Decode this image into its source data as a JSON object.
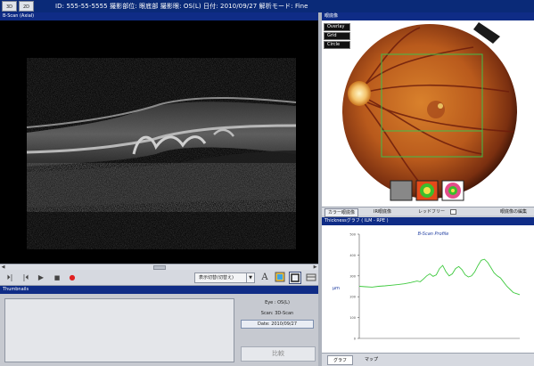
{
  "header": {
    "tab_3d": "3D",
    "tab_2d": "2D",
    "info": "ID: 555-55-5555   撮影部位: 眼底部   撮影眼: OS(L)   日付: 2010/09/27   解析モード: Fine"
  },
  "bscan": {
    "title": "B-Scan (Axial)"
  },
  "player": {
    "view_select": "表示切替(切替え)",
    "font_icon": "A"
  },
  "thumbnails": {
    "title": "Thumbnails",
    "eye": "Eye : OS(L)",
    "scan": "Scan: 3D-Scan",
    "date": "Date: 2010/09/27",
    "compare_label": "比較"
  },
  "fundus": {
    "title": "眼底像",
    "overlay_buttons": [
      "Overlay",
      "Grid",
      "Circle"
    ],
    "toolbar": {
      "color_image": "カラー眼底像",
      "ir_image": "IR眼底像",
      "red_free": "レッドフリー",
      "edit": "眼底像の編集"
    }
  },
  "thickness": {
    "title": "Thicknessグラフ ( ILM - RPE )",
    "tabs": [
      "グラフ",
      "マップ"
    ]
  },
  "chart_data": {
    "type": "line",
    "title": "B-Scan Profile",
    "ylabel": "µm",
    "yticks": [
      0,
      100,
      200,
      300,
      400,
      500
    ],
    "ylim": [
      0,
      500
    ],
    "xlim": [
      0,
      100
    ],
    "series": [
      {
        "color": "#3ec93e",
        "x": [
          0,
          4,
          8,
          12,
          16,
          20,
          24,
          28,
          32,
          36,
          38,
          40,
          42,
          44,
          46,
          48,
          50,
          52,
          54,
          56,
          58,
          60,
          62,
          64,
          66,
          68,
          70,
          72,
          74,
          76,
          78,
          80,
          82,
          84,
          86,
          88,
          90,
          92,
          94,
          96,
          98,
          100
        ],
        "y": [
          250,
          248,
          246,
          250,
          252,
          255,
          258,
          262,
          268,
          275,
          272,
          285,
          300,
          310,
          298,
          305,
          335,
          350,
          320,
          300,
          310,
          335,
          345,
          330,
          305,
          295,
          300,
          320,
          350,
          375,
          380,
          365,
          340,
          315,
          300,
          290,
          270,
          250,
          235,
          220,
          215,
          210
        ]
      }
    ]
  }
}
